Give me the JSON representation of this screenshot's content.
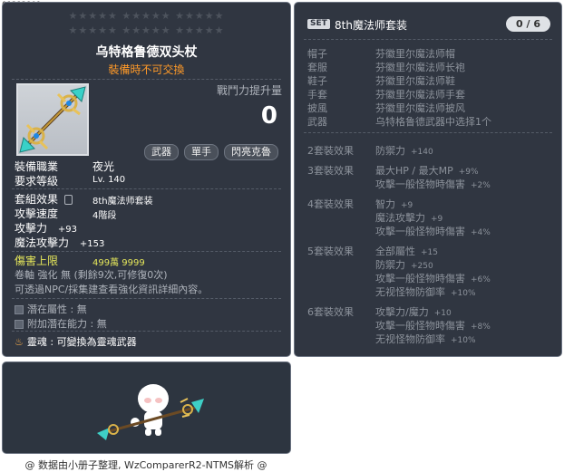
{
  "top_code": "01212101",
  "stars": {
    "row1": "★★★★★  ★★★★★  ★★★★★",
    "row2": "★★★★★  ★★★★★  ★★★★★"
  },
  "item": {
    "name": "乌特格鲁德双头杖",
    "tradable": "裝備時不可交換",
    "power_label": "戰鬥力提升量",
    "power_value": "0",
    "tags": [
      "武器",
      "單手",
      "閃亮克魯"
    ],
    "job_label": "裝備職業",
    "job_value": "夜光",
    "level_label": "要求等級",
    "level_value": "Lv. 140",
    "set_label": "套組效果",
    "set_value": "8th魔法师套装",
    "speed_label": "攻擊速度",
    "speed_value": "4階段",
    "atk_label": "攻擊力",
    "atk_value": "+93",
    "matk_label": "魔法攻擊力",
    "matk_value": "+153",
    "cap_label": "傷害上限",
    "cap_value": "499萬 9999",
    "scroll_text": "卷軸 強化 無 (剩餘9次,可修復0次)",
    "npc_text": "可透過NPC/採集建查看強化資訊詳細內容。",
    "potential_label": "潛在屬性 : 無",
    "bonus_label": "附加潛在能力 : 無",
    "soul_label": "靈魂 : 可變換為靈魂武器"
  },
  "credit": "@ 数据由小册子整理, WzComparerR2-NTMS解析 @",
  "set": {
    "badge": "SET",
    "title": "8th魔法师套装",
    "count": "0 / 6",
    "pieces": [
      {
        "part": "帽子",
        "name": "芬徽里尔魔法师帽"
      },
      {
        "part": "套服",
        "name": "芬徽里尔魔法师长袍"
      },
      {
        "part": "鞋子",
        "name": "芬徽里尔魔法师鞋"
      },
      {
        "part": "手套",
        "name": "芬徽里尔魔法师手套"
      },
      {
        "part": "披風",
        "name": "芬徽里尔魔法师披风"
      },
      {
        "part": "武器",
        "name": "乌特格鲁德武器中选择1个"
      }
    ],
    "effects": [
      {
        "label": "2套裝效果",
        "lines": [
          {
            "k": "防禦力",
            "v": "+140"
          }
        ]
      },
      {
        "label": "3套裝效果",
        "lines": [
          {
            "k": "最大HP / 最大MP",
            "v": "+9%"
          },
          {
            "k": "攻擊一般怪物時傷害",
            "v": "+2%"
          }
        ]
      },
      {
        "label": "4套裝效果",
        "lines": [
          {
            "k": "智力",
            "v": "+9"
          },
          {
            "k": "魔法攻擊力",
            "v": "+9"
          },
          {
            "k": "攻擊一般怪物時傷害",
            "v": "+4%"
          }
        ]
      },
      {
        "label": "5套裝效果",
        "lines": [
          {
            "k": "全部屬性",
            "v": "+15"
          },
          {
            "k": "防禦力",
            "v": "+250"
          },
          {
            "k": "攻擊一般怪物時傷害",
            "v": "+6%"
          },
          {
            "k": "无视怪物防御率",
            "v": "+10%"
          }
        ]
      },
      {
        "label": "6套裝效果",
        "lines": [
          {
            "k": "攻擊力/魔力",
            "v": "+10"
          },
          {
            "k": "攻擊一般怪物時傷害",
            "v": "+8%"
          },
          {
            "k": "无视怪物防御率",
            "v": "+10%"
          }
        ]
      }
    ]
  }
}
